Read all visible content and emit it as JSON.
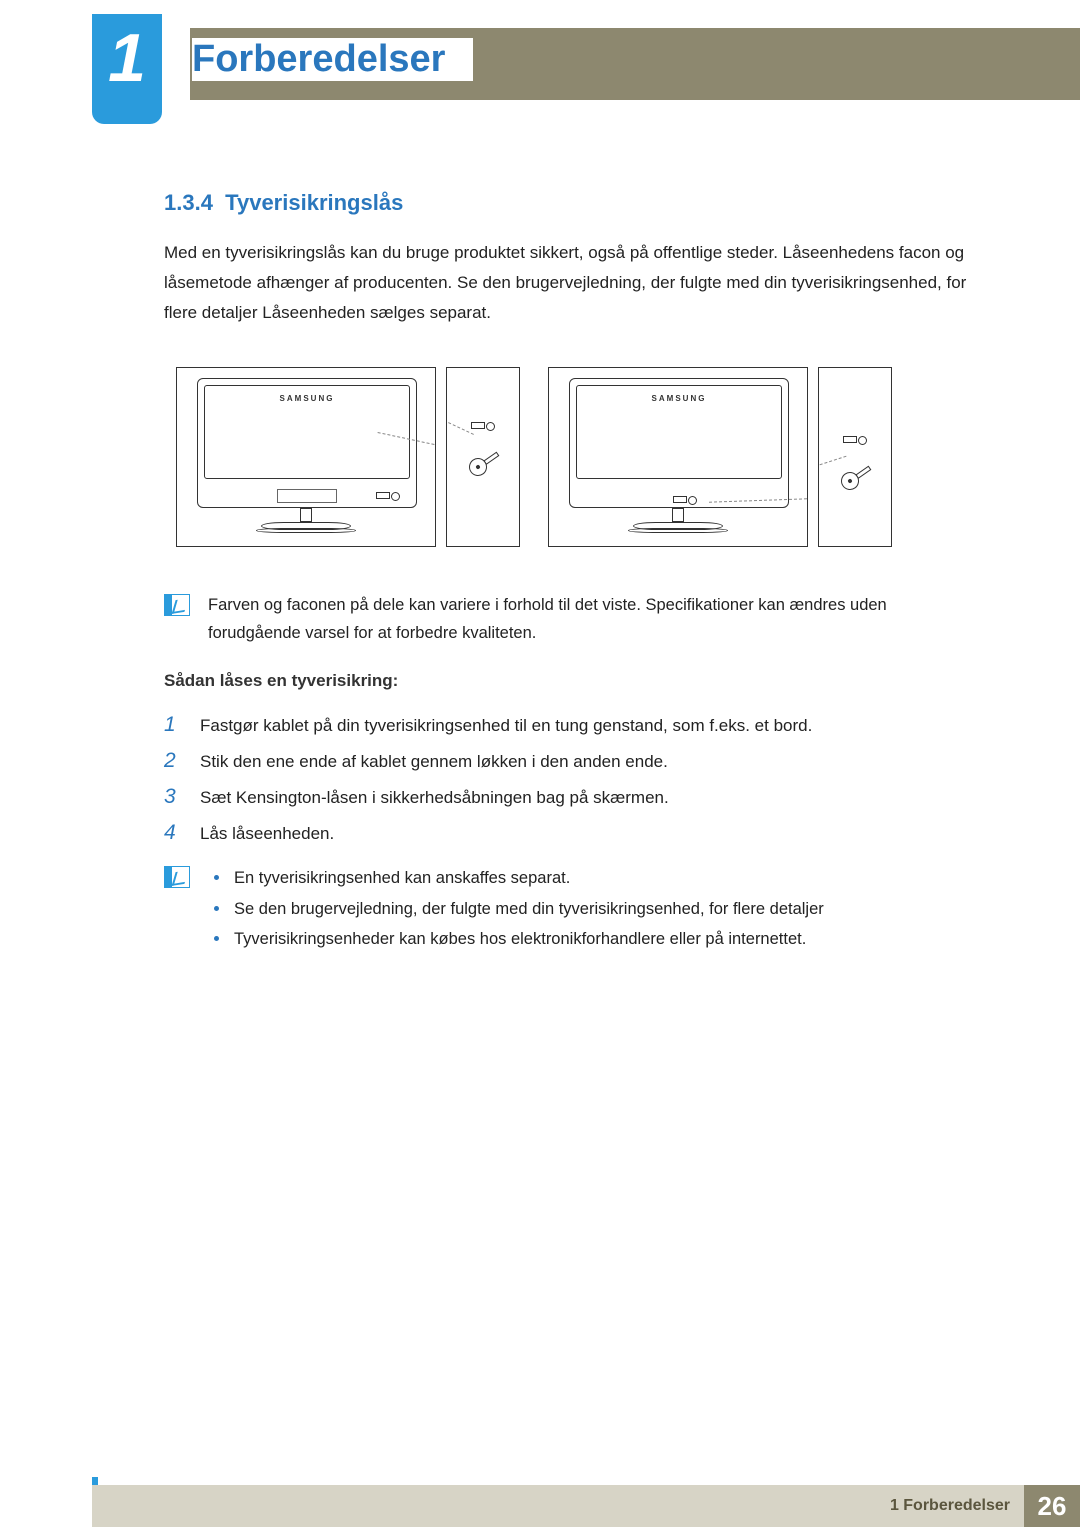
{
  "header": {
    "chapter_number": "1",
    "chapter_title": "Forberedelser"
  },
  "section": {
    "number": "1.3.4",
    "title": "Tyverisikringslås",
    "intro": "Med en tyverisikringslås kan du bruge produktet sikkert, også på offentlige steder. Låseenhedens facon og låsemetode afhænger af producenten. Se den brugervejledning, der fulgte med din tyverisikringsenhed, for flere detaljer Låseenheden sælges separat."
  },
  "figure_brand": "SAMSUNG",
  "note1": "Farven og faconen på dele kan variere i forhold til det viste. Specifikationer kan ændres uden forudgående varsel for at forbedre kvaliteten.",
  "howto_heading": "Sådan låses en tyverisikring:",
  "steps": [
    "Fastgør kablet på din tyverisikringsenhed til en tung genstand, som f.eks. et bord.",
    "Stik den ene ende af kablet gennem løkken i den anden ende.",
    "Sæt Kensington-låsen i sikkerhedsåbningen bag på skærmen.",
    "Lås låseenheden."
  ],
  "note2_bullets": [
    "En tyverisikringsenhed kan anskaffes separat.",
    "Se den brugervejledning, der fulgte med din tyverisikringsenhed, for flere detaljer",
    "Tyverisikringsenheder kan købes hos elektronikforhandlere eller på internettet."
  ],
  "footer": {
    "label": "1 Forberedelser",
    "page": "26"
  }
}
